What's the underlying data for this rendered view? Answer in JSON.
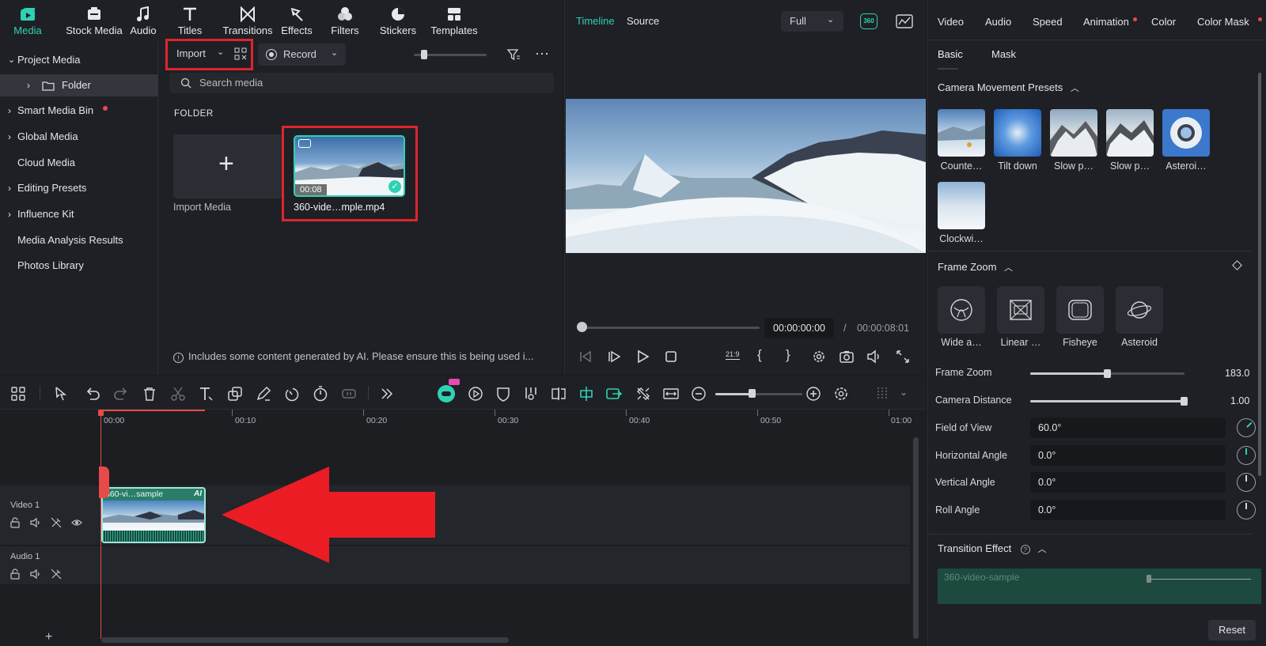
{
  "toolbar": {
    "items": [
      {
        "label": "Media",
        "icon": "media-icon",
        "active": true
      },
      {
        "label": "Stock Media",
        "icon": "stock-media-icon"
      },
      {
        "label": "Audio",
        "icon": "audio-note-icon"
      },
      {
        "label": "Titles",
        "icon": "titles-icon"
      },
      {
        "label": "Transitions",
        "icon": "transitions-icon"
      },
      {
        "label": "Effects",
        "icon": "effects-icon"
      },
      {
        "label": "Filters",
        "icon": "filters-icon"
      },
      {
        "label": "Stickers",
        "icon": "stickers-icon"
      },
      {
        "label": "Templates",
        "icon": "templates-icon"
      }
    ]
  },
  "sidebar": {
    "items": [
      {
        "label": "Project Media"
      },
      {
        "label": "Folder"
      },
      {
        "label": "Smart Media Bin"
      },
      {
        "label": "Global Media"
      },
      {
        "label": "Cloud Media"
      },
      {
        "label": "Editing Presets"
      },
      {
        "label": "Influence Kit"
      },
      {
        "label": "Media Analysis Results"
      },
      {
        "label": "Photos Library"
      }
    ]
  },
  "media": {
    "import_label": "Import",
    "record_label": "Record",
    "search_placeholder": "Search media",
    "folder_heading": "FOLDER",
    "import_media_label": "Import Media",
    "clip_duration": "00:08",
    "clip_name": "360-vide…mple.mp4",
    "ai_notice": "Includes some content generated by AI. Please ensure this is being used i..."
  },
  "preview": {
    "tab_timeline": "Timeline",
    "tab_source": "Source",
    "quality": "Full",
    "badge_360": "360",
    "current_time": "00:00:00:00",
    "separator": "/",
    "total_time": "00:00:08:01",
    "aspect": "21:9"
  },
  "timeline": {
    "ruler": [
      "00:00",
      "00:10",
      "00:20",
      "00:30",
      "00:40",
      "00:50",
      "01:00"
    ],
    "video_track_label": "Video 1",
    "audio_track_label": "Audio 1",
    "clip_title": "360-vi…sample",
    "clip_ai_badge": "AI",
    "add_track": "+"
  },
  "right_panel": {
    "tabs": [
      "Video",
      "Audio",
      "Speed",
      "Animation",
      "Color",
      "Color Mask"
    ],
    "subtabs": [
      "Basic",
      "Mask"
    ],
    "camera_presets_heading": "Camera Movement Presets",
    "presets": [
      "Counte…",
      "Tilt down",
      "Slow p…",
      "Slow p…",
      "Asteroi…",
      "Clockwi…"
    ],
    "frame_zoom_heading": "Frame Zoom",
    "lenses": [
      "Wide a…",
      "Linear …",
      "Fisheye",
      "Asteroid"
    ],
    "frame_zoom_label": "Frame Zoom",
    "frame_zoom_value": "183.0",
    "frame_zoom_level": 0.5,
    "camera_distance_label": "Camera Distance",
    "camera_distance_value": "1.00",
    "camera_distance_level": 1.0,
    "fov_label": "Field of View",
    "fov_value": "60.0°",
    "horizontal_label": "Horizontal Angle",
    "horizontal_value": "0.0°",
    "vertical_label": "Vertical Angle",
    "vertical_value": "0.0°",
    "roll_label": "Roll Angle",
    "roll_value": "0.0°",
    "transition_heading": "Transition Effect",
    "transition_clip": "360-video-sample",
    "reset_label": "Reset"
  },
  "colors": {
    "accent": "#2fd1b5",
    "highlight": "#e0242b",
    "playhead": "#e84a4a"
  }
}
